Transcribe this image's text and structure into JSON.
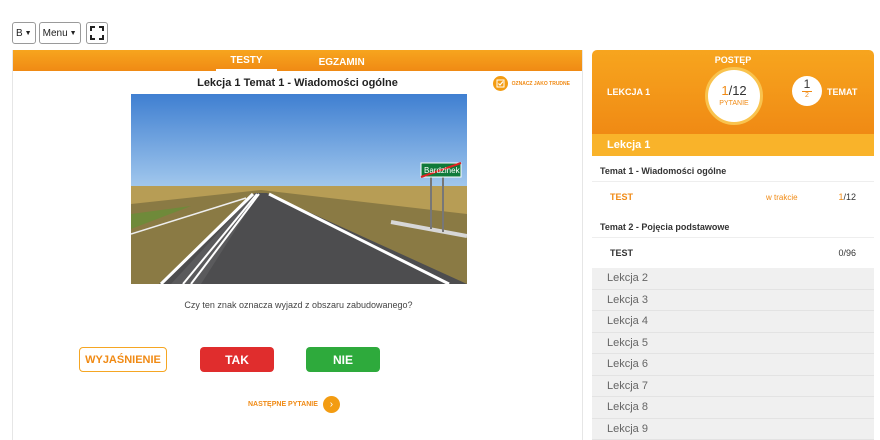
{
  "topbar": {
    "lang_value": "B",
    "menu_value": "Menu"
  },
  "tabs": [
    {
      "label": "TESTY",
      "active": true
    },
    {
      "label": "EGZAMIN",
      "active": false
    }
  ],
  "lesson_title": "Lekcja 1 Temat 1 - Wiadomości ogólne",
  "mark_difficult_label": "OZNACZ JAKO TRUDNE",
  "photo": {
    "sign_text": "Bardzinek"
  },
  "question": "Czy ten znak oznacza wyjazd z obszaru zabudowanego?",
  "buttons": {
    "explanation": "WYJAŚNIENIE",
    "yes": "TAK",
    "no": "NIE"
  },
  "next_label": "NASTĘPNE PYTANIE",
  "progress": {
    "title": "POSTĘP",
    "lesson_label": "LEKCJA 1",
    "question_current": "1",
    "question_total": "/12",
    "question_label": "PYTANIE",
    "topic_current": "1",
    "topic_total": "2",
    "topic_label": "TEMAT"
  },
  "active_lesson": "Lekcja 1",
  "topics": [
    {
      "title": "Temat 1 - Wiadomości ogólne",
      "test": "TEST",
      "status": "w trakcie",
      "done": "1",
      "total": "/12"
    },
    {
      "title": "Temat 2 - Pojęcia podstawowe",
      "test": "TEST",
      "status": "",
      "done": "0",
      "total": "/96"
    }
  ],
  "lessons": [
    "Lekcja 2",
    "Lekcja 3",
    "Lekcja 4",
    "Lekcja 5",
    "Lekcja 6",
    "Lekcja 7",
    "Lekcja 8",
    "Lekcja 9"
  ],
  "colors": {
    "accent": "#f39c12",
    "yes": "#e02d2d",
    "no": "#2eaa3c"
  }
}
